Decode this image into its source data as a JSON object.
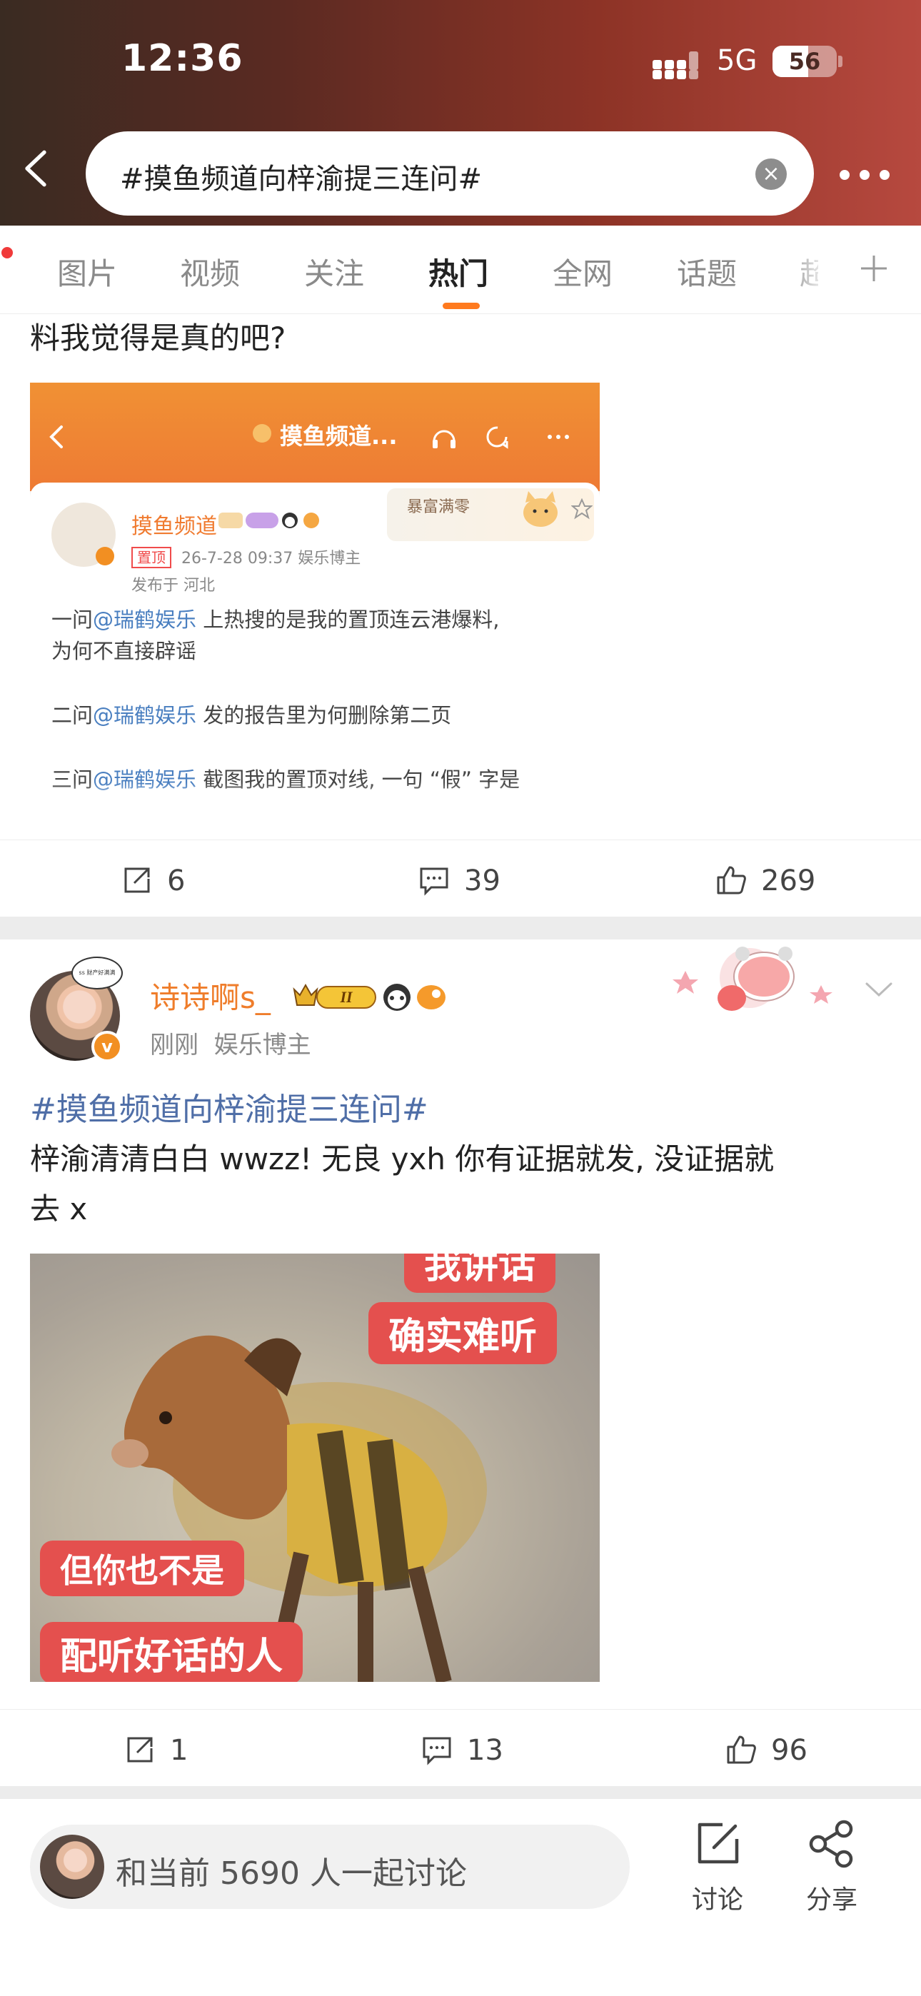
{
  "status_bar": {
    "time": "12:36",
    "network": "5G",
    "battery": "56"
  },
  "search": {
    "query": "#摸鱼频道向梓渝提三连问#"
  },
  "tabs": [
    "图片",
    "视频",
    "关注",
    "热门",
    "全网",
    "话题",
    "超"
  ],
  "active_tab": "热门",
  "post1": {
    "text_tail": "料我觉得是真的吧?",
    "screenshot": {
      "title": "摸鱼频道...",
      "name": "摸鱼频道",
      "pinned": "置顶",
      "meta": "26-7-28 09:37  娱乐博主",
      "location": "发布于 河北",
      "sticker": "暴富满零",
      "lines": [
        {
          "prefix": "一问",
          "mention": "@瑞鹤娱乐",
          "rest": " 上热搜的是我的置顶连云港爆料,"
        },
        {
          "prefix": "",
          "mention": "",
          "rest": "为何不直接辟谣"
        },
        {
          "prefix": "二问",
          "mention": "@瑞鹤娱乐",
          "rest": " 发的报告里为何删除第二页"
        },
        {
          "prefix": "三问",
          "mention": "@瑞鹤娱乐",
          "rest": " 截图我的置顶对线, 一句 “假” 字是"
        }
      ]
    },
    "reposts": "6",
    "comments": "39",
    "likes": "269"
  },
  "post2": {
    "username": "诗诗啊s_",
    "time": "刚刚",
    "role": "娱乐博主",
    "avatar_bubble": "ss 财产好满满",
    "topic": "#摸鱼频道向梓渝提三连问#",
    "body_line1": "梓渝清清白白 wwzz! 无良 yxh 你有证据就发, 没证据就",
    "body_line2": "去 x",
    "meme_labels": [
      "我讲话",
      "确实难听",
      "但你也不是",
      "配听好话的人"
    ],
    "reposts": "1",
    "comments": "13",
    "likes": "96"
  },
  "bottom_bar": {
    "discuss_placeholder": "和当前 5690 人一起讨论",
    "discuss_label": "讨论",
    "share_label": "分享"
  },
  "colors": {
    "accent": "#ff7a1e",
    "username": "#ef7d2b",
    "topic": "#4f6ea7",
    "header_end": "#b7493f"
  }
}
